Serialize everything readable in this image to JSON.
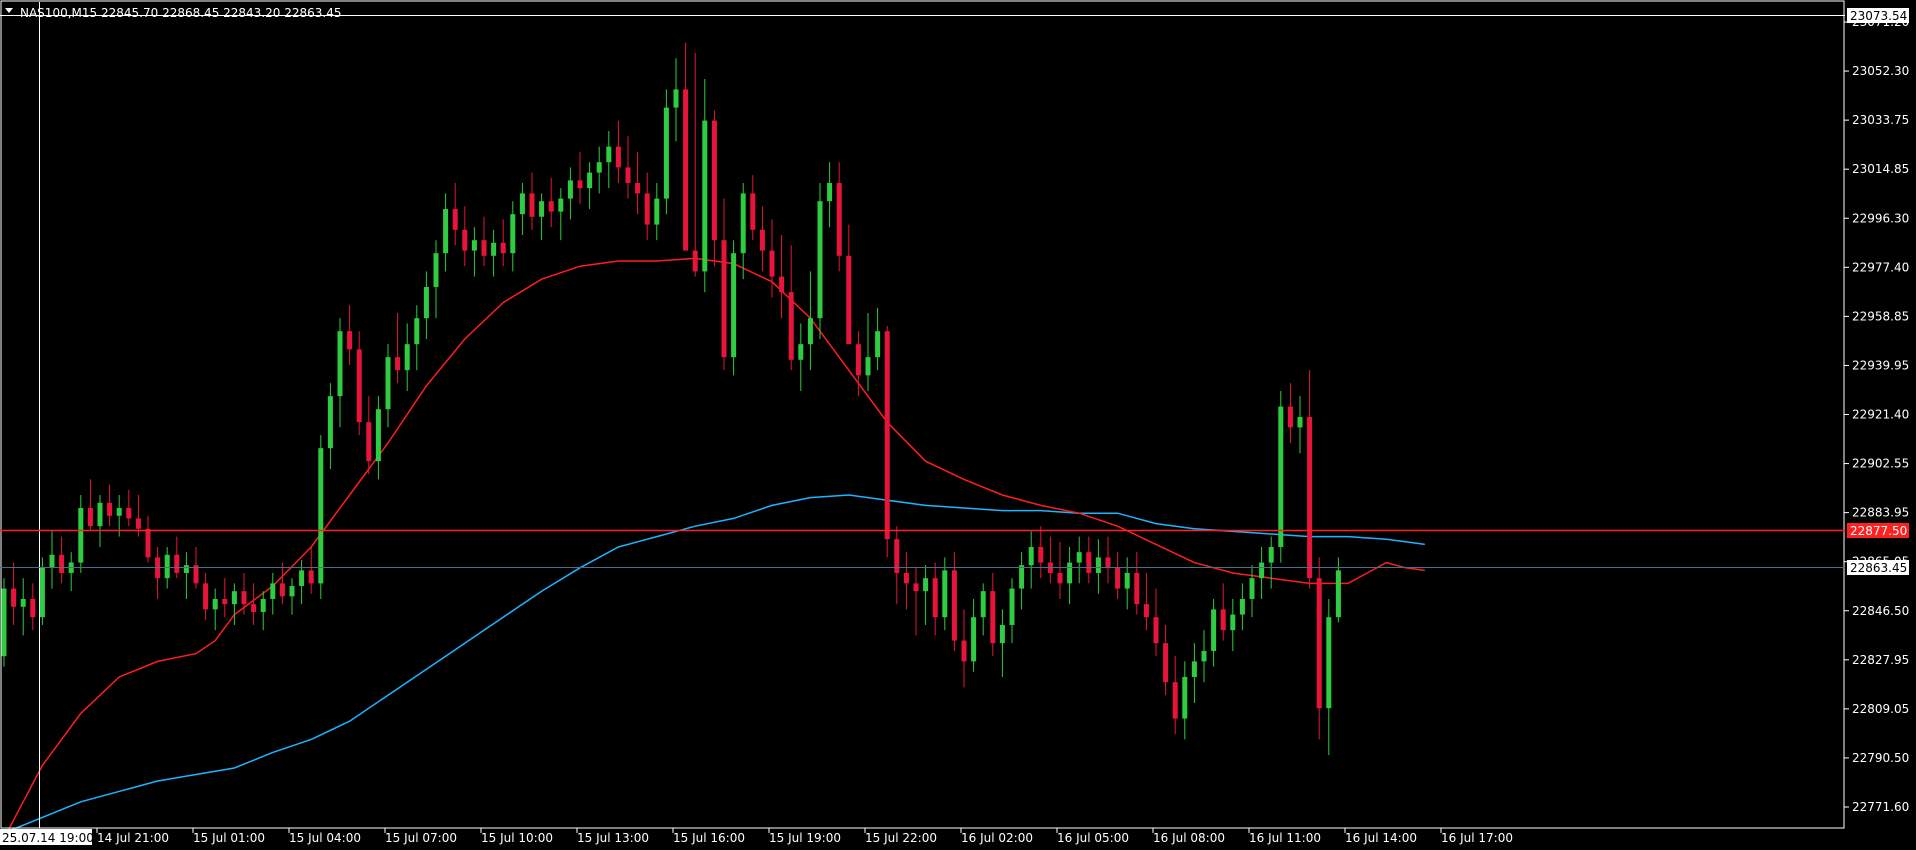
{
  "header": {
    "dropdown_icon": "triangle-down-icon",
    "symbol": "NAS100,M15",
    "ohlc": "22845.70 22868.45 22843.20 22863.45"
  },
  "chart_data": {
    "type": "candlestick",
    "symbol": "NAS100",
    "timeframe": "M15",
    "ylim": [
      22771.6,
      23073.54
    ],
    "y_ticks": [
      "23071.20",
      "23052.30",
      "23033.75",
      "23014.85",
      "22996.30",
      "22977.40",
      "22958.85",
      "22939.95",
      "22921.40",
      "22902.55",
      "22883.95",
      "22865.05",
      "22846.50",
      "22827.95",
      "22809.05",
      "22790.50",
      "22771.60"
    ],
    "x_labels": [
      "25.07.14 19:00",
      "14 Jul 21:00",
      "15 Jul 01:00",
      "15 Jul 04:00",
      "15 Jul 07:00",
      "15 Jul 10:00",
      "15 Jul 13:00",
      "15 Jul 16:00",
      "15 Jul 19:00",
      "15 Jul 22:00",
      "16 Jul 02:00",
      "16 Jul 05:00",
      "16 Jul 08:00",
      "16 Jul 11:00",
      "16 Jul 14:00",
      "16 Jul 17:00"
    ],
    "crosshair_price": "23073.54",
    "alert_line_price": "22877.50",
    "current_price": "22863.45",
    "colors": {
      "background": "#000000",
      "bull": "#2ecc40",
      "bear": "#e8143c",
      "ma_fast": "#ff1e1e",
      "ma_slow": "#1eb4ff",
      "alert_line": "#ff2020",
      "current_line": "#4a6f8c",
      "text": "#ffffff"
    },
    "ma_fast": [
      [
        0,
        22760
      ],
      [
        4,
        22788
      ],
      [
        8,
        22808
      ],
      [
        12,
        22822
      ],
      [
        16,
        22828
      ],
      [
        20,
        22831
      ],
      [
        22,
        22836
      ],
      [
        24,
        22846
      ],
      [
        28,
        22857
      ],
      [
        32,
        22872
      ],
      [
        36,
        22892
      ],
      [
        40,
        22912
      ],
      [
        44,
        22934
      ],
      [
        48,
        22952
      ],
      [
        52,
        22966
      ],
      [
        56,
        22975
      ],
      [
        60,
        22980
      ],
      [
        64,
        22982
      ],
      [
        68,
        22982
      ],
      [
        72,
        22983
      ],
      [
        76,
        22981
      ],
      [
        80,
        22974
      ],
      [
        84,
        22960
      ],
      [
        88,
        22940
      ],
      [
        92,
        22920
      ],
      [
        96,
        22905
      ],
      [
        100,
        22898
      ],
      [
        104,
        22892
      ],
      [
        108,
        22888
      ],
      [
        112,
        22885
      ],
      [
        116,
        22880
      ],
      [
        120,
        22873
      ],
      [
        124,
        22866
      ],
      [
        128,
        22862
      ],
      [
        132,
        22860
      ],
      [
        136,
        22858
      ],
      [
        140,
        22858
      ],
      [
        142,
        22862
      ],
      [
        144,
        22866
      ],
      [
        146,
        22864
      ],
      [
        148,
        22863
      ]
    ],
    "ma_slow": [
      [
        0,
        22762
      ],
      [
        8,
        22774
      ],
      [
        16,
        22782
      ],
      [
        24,
        22787
      ],
      [
        28,
        22793
      ],
      [
        32,
        22798
      ],
      [
        36,
        22805
      ],
      [
        40,
        22815
      ],
      [
        44,
        22825
      ],
      [
        48,
        22835
      ],
      [
        52,
        22845
      ],
      [
        56,
        22855
      ],
      [
        60,
        22864
      ],
      [
        64,
        22872
      ],
      [
        68,
        22876
      ],
      [
        72,
        22880
      ],
      [
        76,
        22883
      ],
      [
        80,
        22888
      ],
      [
        84,
        22891
      ],
      [
        88,
        22892
      ],
      [
        92,
        22890
      ],
      [
        96,
        22888
      ],
      [
        100,
        22887
      ],
      [
        104,
        22886
      ],
      [
        108,
        22886
      ],
      [
        112,
        22885
      ],
      [
        116,
        22885
      ],
      [
        120,
        22881
      ],
      [
        124,
        22879
      ],
      [
        128,
        22878
      ],
      [
        132,
        22877
      ],
      [
        136,
        22876
      ],
      [
        140,
        22876
      ],
      [
        144,
        22875
      ],
      [
        146,
        22874
      ],
      [
        148,
        22873
      ]
    ],
    "candles": [
      [
        22830,
        22860,
        22826,
        22856
      ],
      [
        22856,
        22866,
        22842,
        22849
      ],
      [
        22849,
        22860,
        22838,
        22852
      ],
      [
        22852,
        22858,
        22840,
        22845
      ],
      [
        22845,
        22868,
        22842,
        22864
      ],
      [
        22864,
        22878,
        22856,
        22869
      ],
      [
        22869,
        22876,
        22858,
        22862
      ],
      [
        22862,
        22870,
        22855,
        22866
      ],
      [
        22866,
        22892,
        22862,
        22887
      ],
      [
        22887,
        22898,
        22878,
        22880
      ],
      [
        22880,
        22892,
        22872,
        22889
      ],
      [
        22889,
        22896,
        22880,
        22884
      ],
      [
        22884,
        22892,
        22876,
        22887
      ],
      [
        22887,
        22894,
        22880,
        22883
      ],
      [
        22883,
        22892,
        22876,
        22879
      ],
      [
        22879,
        22884,
        22866,
        22868
      ],
      [
        22868,
        22872,
        22852,
        22860
      ],
      [
        22860,
        22872,
        22856,
        22869
      ],
      [
        22869,
        22876,
        22860,
        22862
      ],
      [
        22862,
        22870,
        22852,
        22865
      ],
      [
        22865,
        22872,
        22856,
        22858
      ],
      [
        22858,
        22862,
        22844,
        22848
      ],
      [
        22848,
        22856,
        22840,
        22852
      ],
      [
        22852,
        22860,
        22845,
        22850
      ],
      [
        22850,
        22858,
        22842,
        22855
      ],
      [
        22855,
        22862,
        22846,
        22850
      ],
      [
        22850,
        22858,
        22842,
        22847
      ],
      [
        22847,
        22855,
        22840,
        22852
      ],
      [
        22852,
        22862,
        22846,
        22858
      ],
      [
        22858,
        22866,
        22850,
        22853
      ],
      [
        22853,
        22860,
        22846,
        22857
      ],
      [
        22857,
        22867,
        22850,
        22863
      ],
      [
        22863,
        22872,
        22854,
        22858
      ],
      [
        22858,
        22915,
        22852,
        22910
      ],
      [
        22910,
        22935,
        22902,
        22930
      ],
      [
        22930,
        22960,
        22918,
        22955
      ],
      [
        22955,
        22965,
        22942,
        22948
      ],
      [
        22948,
        22955,
        22915,
        22920
      ],
      [
        22920,
        22930,
        22900,
        22905
      ],
      [
        22905,
        22930,
        22898,
        22925
      ],
      [
        22925,
        22950,
        22918,
        22945
      ],
      [
        22945,
        22962,
        22935,
        22940
      ],
      [
        22940,
        22958,
        22932,
        22950
      ],
      [
        22950,
        22965,
        22940,
        22960
      ],
      [
        22960,
        22978,
        22952,
        22972
      ],
      [
        22972,
        22990,
        22960,
        22985
      ],
      [
        22985,
        23008,
        22978,
        23002
      ],
      [
        23002,
        23012,
        22988,
        22994
      ],
      [
        22994,
        23003,
        22980,
        22986
      ],
      [
        22986,
        22995,
        22976,
        22990
      ],
      [
        22990,
        22999,
        22980,
        22984
      ],
      [
        22984,
        22994,
        22976,
        22989
      ],
      [
        22989,
        22998,
        22980,
        22985
      ],
      [
        22985,
        23005,
        22978,
        23000
      ],
      [
        23000,
        23012,
        22992,
        23008
      ],
      [
        23008,
        23016,
        22994,
        22999
      ],
      [
        22999,
        23008,
        22990,
        23005
      ],
      [
        23005,
        23014,
        22995,
        23001
      ],
      [
        23001,
        23010,
        22990,
        23006
      ],
      [
        23006,
        23018,
        22998,
        23013
      ],
      [
        23013,
        23024,
        23004,
        23010
      ],
      [
        23010,
        23020,
        23002,
        23016
      ],
      [
        23016,
        23026,
        23008,
        23020
      ],
      [
        23020,
        23032,
        23010,
        23026
      ],
      [
        23026,
        23036,
        23012,
        23018
      ],
      [
        23018,
        23030,
        23006,
        23012
      ],
      [
        23012,
        23024,
        23000,
        23008
      ],
      [
        23008,
        23016,
        22990,
        22996
      ],
      [
        22996,
        23012,
        22990,
        23006
      ],
      [
        23006,
        23048,
        23000,
        23041
      ],
      [
        23041,
        23060,
        23028,
        23048
      ],
      [
        23048,
        23066,
        23036,
        22986
      ],
      [
        22986,
        23062,
        22976,
        22978
      ],
      [
        22978,
        23052,
        22970,
        23036
      ],
      [
        23036,
        23040,
        22980,
        22990
      ],
      [
        22990,
        23006,
        22940,
        22945
      ],
      [
        22945,
        22990,
        22938,
        22985
      ],
      [
        22985,
        23012,
        22975,
        23008
      ],
      [
        23008,
        23015,
        22990,
        22994
      ],
      [
        22994,
        23003,
        22978,
        22986
      ],
      [
        22986,
        22998,
        22968,
        22976
      ],
      [
        22976,
        22992,
        22960,
        22970
      ],
      [
        22970,
        22988,
        22940,
        22944
      ],
      [
        22944,
        22958,
        22932,
        22950
      ],
      [
        22950,
        22978,
        22940,
        22960
      ],
      [
        22960,
        23012,
        22952,
        23005
      ],
      [
        23005,
        23020,
        22995,
        23012
      ],
      [
        23012,
        23020,
        22978,
        22984
      ],
      [
        22984,
        22996,
        22960,
        22950
      ],
      [
        22950,
        22955,
        22930,
        22938
      ],
      [
        22938,
        22962,
        22932,
        22945
      ],
      [
        22945,
        22964,
        22940,
        22955
      ],
      [
        22955,
        22957,
        22868,
        22875
      ],
      [
        22875,
        22880,
        22850,
        22862
      ],
      [
        22862,
        22870,
        22848,
        22858
      ],
      [
        22858,
        22864,
        22838,
        22855
      ],
      [
        22855,
        22865,
        22842,
        22860
      ],
      [
        22860,
        22866,
        22838,
        22845
      ],
      [
        22845,
        22868,
        22840,
        22863
      ],
      [
        22863,
        22870,
        22832,
        22836
      ],
      [
        22836,
        22848,
        22818,
        22828
      ],
      [
        22828,
        22852,
        22824,
        22845
      ],
      [
        22845,
        22858,
        22838,
        22855
      ],
      [
        22855,
        22862,
        22830,
        22835
      ],
      [
        22835,
        22848,
        22822,
        22842
      ],
      [
        22842,
        22860,
        22835,
        22856
      ],
      [
        22856,
        22870,
        22848,
        22865
      ],
      [
        22865,
        22878,
        22856,
        22872
      ],
      [
        22872,
        22880,
        22860,
        22866
      ],
      [
        22866,
        22876,
        22858,
        22862
      ],
      [
        22862,
        22874,
        22852,
        22858
      ],
      [
        22858,
        22872,
        22850,
        22866
      ],
      [
        22866,
        22876,
        22858,
        22870
      ],
      [
        22870,
        22876,
        22858,
        22862
      ],
      [
        22862,
        22875,
        22854,
        22868
      ],
      [
        22868,
        22876,
        22858,
        22864
      ],
      [
        22864,
        22870,
        22852,
        22856
      ],
      [
        22856,
        22868,
        22848,
        22862
      ],
      [
        22862,
        22870,
        22846,
        22850
      ],
      [
        22850,
        22862,
        22840,
        22845
      ],
      [
        22845,
        22856,
        22830,
        22835
      ],
      [
        22835,
        22842,
        22815,
        22820
      ],
      [
        22820,
        22830,
        22800,
        22806
      ],
      [
        22806,
        22828,
        22798,
        22822
      ],
      [
        22822,
        22835,
        22812,
        22828
      ],
      [
        22828,
        22840,
        22820,
        22832
      ],
      [
        22832,
        22852,
        22826,
        22848
      ],
      [
        22848,
        22858,
        22836,
        22840
      ],
      [
        22840,
        22852,
        22832,
        22846
      ],
      [
        22846,
        22858,
        22840,
        22852
      ],
      [
        22852,
        22865,
        22845,
        22860
      ],
      [
        22860,
        22872,
        22852,
        22866
      ],
      [
        22866,
        22876,
        22856,
        22872
      ],
      [
        22872,
        22932,
        22866,
        22926
      ],
      [
        22926,
        22935,
        22912,
        22918
      ],
      [
        22918,
        22930,
        22908,
        22922
      ],
      [
        22922,
        22940,
        22856,
        22860
      ],
      [
        22860,
        22868,
        22798,
        22810
      ],
      [
        22810,
        22852,
        22792,
        22845
      ],
      [
        22845,
        22868,
        22843,
        22863
      ]
    ]
  }
}
